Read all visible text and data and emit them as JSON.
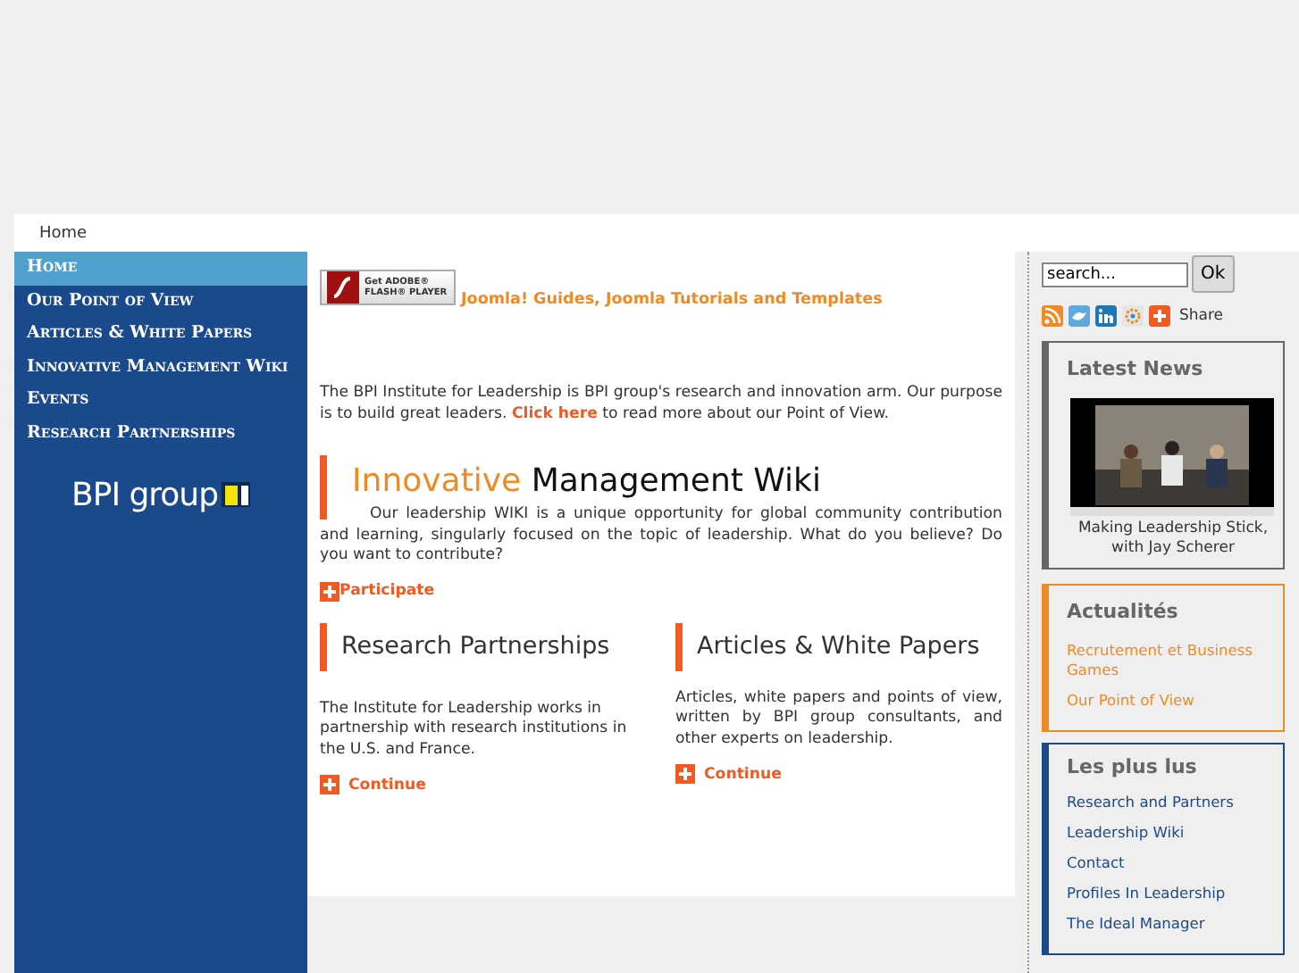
{
  "breadcrumb": "Home",
  "nav": [
    {
      "label": "Home",
      "selected": true
    },
    {
      "label": "Our Point of View",
      "selected": false
    },
    {
      "label": "Articles & White Papers",
      "selected": false
    },
    {
      "label": "Innovative Management Wiki",
      "selected": false
    },
    {
      "label": "Events",
      "selected": false
    },
    {
      "label": "Research Partnerships",
      "selected": false
    }
  ],
  "logo": {
    "text": "BPI group"
  },
  "flash_badge": {
    "line1": "Get ADOBE®",
    "line2": "FLASH® PLAYER"
  },
  "top_link": "Joomla! Guides, Joomla Tutorials and Templates",
  "intro": "The BPI Institute for Leadership is BPI group's research and innovation arm. Our purpose is to build great leaders.",
  "intro_link": "Click here",
  "intro_tail": "to read more about our Point of View.",
  "wiki": {
    "title_accent": "Innovative",
    "title_rest": "Management Wiki",
    "text": "Our leadership WIKI is a unique opportunity for global community contribution and learning, singularly focused on the topic of leadership. What do you believe? Do you want to contribute?",
    "link": "Participate"
  },
  "columns": [
    {
      "title": "Research Partnerships",
      "text": "The Institute for Leadership works in partnership with research institutions in the U.S. and France.",
      "link": "Continue"
    },
    {
      "title": "Articles & White Papers",
      "text": "Articles, white papers and points of view, written by BPI group consultants, and other experts on leadership.",
      "link": "Continue"
    }
  ],
  "search": {
    "value": "search...",
    "button": "Ok"
  },
  "share_label": "Share",
  "boxes": [
    {
      "kind": "news",
      "title": "Latest News",
      "caption": "Making Leadership Stick, with Jay Scherer",
      "color": "#666666"
    },
    {
      "kind": "links",
      "title": "Actualités",
      "color": "#f08a24",
      "links": [
        "Recrutement et Business Games",
        "Our Point of View"
      ]
    },
    {
      "kind": "links",
      "title": "Les plus lus",
      "color": "#1c4b8c",
      "links": [
        "Research and Partners",
        "Leadership Wiki",
        "Contact",
        "Profiles In Leadership",
        "The Ideal Manager"
      ]
    }
  ]
}
